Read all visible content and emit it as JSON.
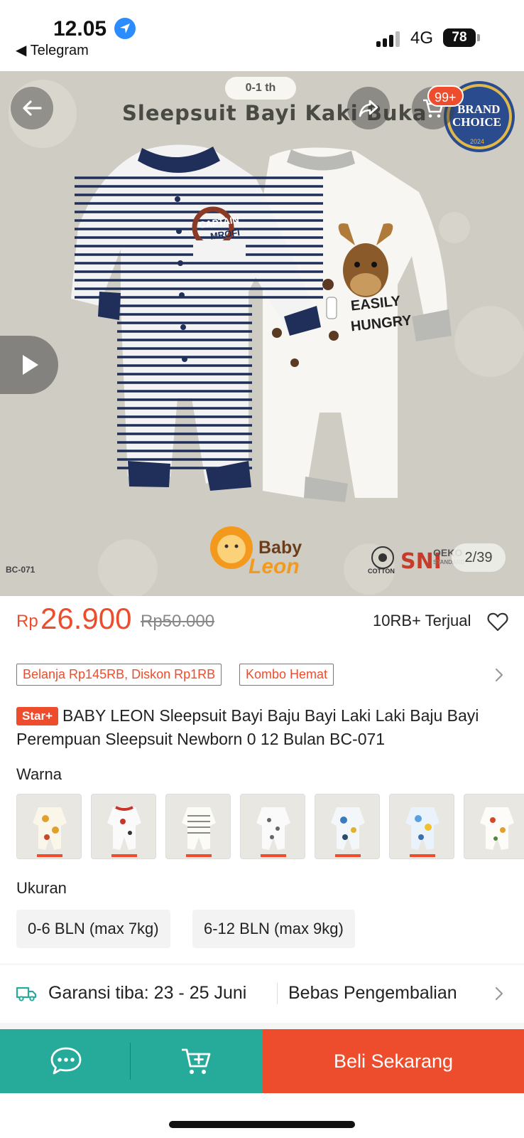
{
  "status_bar": {
    "time": "12.05",
    "back_app": "◀ Telegram",
    "network": "4G",
    "battery": "78"
  },
  "gallery": {
    "age_label": "0-1 th",
    "image_title": "Sleepsuit Bayi Kaki Buka",
    "cart_count": "99+",
    "brand_badge_line1": "BRAND",
    "brand_badge_line2": "CHOICE",
    "brand_badge_year": "2024",
    "sku_code": "BC-071",
    "brand_logo_line1": "Baby",
    "brand_logo_line2": "Leon",
    "cert_cotton": "COTTON",
    "cert_sni": "SNI",
    "cert_oeko": "OEKO",
    "cert_oeko_sub": "STANDARD",
    "page_indicator": "2/39",
    "left_print_1": "CAPTAIN",
    "left_print_2": "MROFI",
    "right_print_1": "EASILY",
    "right_print_2": "HUNGRY"
  },
  "price": {
    "currency": "Rp",
    "current": "26.900",
    "original": "Rp50.000",
    "sold": "10RB+ Terjual"
  },
  "vouchers": [
    "Belanja Rp145RB, Diskon Rp1RB",
    "Kombo Hemat"
  ],
  "product": {
    "badge": "Star+",
    "title": "BABY LEON Sleepsuit Bayi Baju Bayi Laki Laki Baju Bayi Perempuan Sleepsuit Newborn 0 12 Bulan BC-071"
  },
  "variants": {
    "color_label": "Warna",
    "size_label": "Ukuran",
    "sizes": [
      "0-6 BLN (max 7kg)",
      "6-12 BLN (max 9kg)"
    ]
  },
  "shipping": {
    "guarantee": "Garansi tiba: 23 - 25 Juni",
    "returns": "Bebas Pengembalian"
  },
  "bottom_bar": {
    "buy_now": "Beli Sekarang"
  },
  "colors": {
    "accent": "#ee4d2d",
    "teal": "#26aa99"
  }
}
